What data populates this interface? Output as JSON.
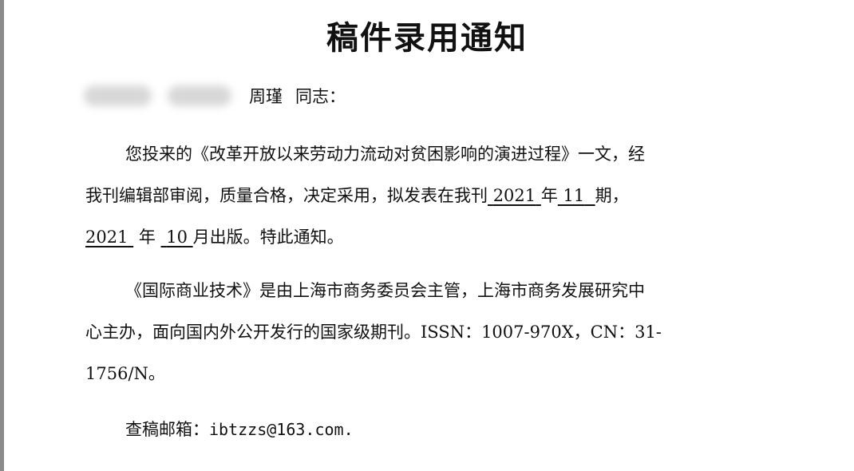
{
  "title": "稿件录用通知",
  "salutation": {
    "name": "周瑾",
    "suffix": "同志："
  },
  "paragraph1": {
    "line1": "您投来的《改革开放以来劳动力流动对贫困影响的演进过程》一文，经",
    "line2_prefix": "我刊编辑部审阅，质量合格，决定采用，拟发表在我刊",
    "issue_year": "2021",
    "year_char": "年",
    "issue_number": "11",
    "issue_suffix": "期，",
    "pub_year": "2021",
    "pub_year_char": "年",
    "pub_month": "10",
    "line3_suffix": "月出版。特此通知。"
  },
  "paragraph2": {
    "line1": "《国际商业技术》是由上海市商务委员会主管，上海市商务发展研究中",
    "line2": "心主办，面向国内外公开发行的国家级期刊。ISSN：1007-970X，CN：31-",
    "line3": "1756/N。"
  },
  "email": {
    "label": "查稿邮箱：",
    "value": "ibtzzs@163.com."
  }
}
